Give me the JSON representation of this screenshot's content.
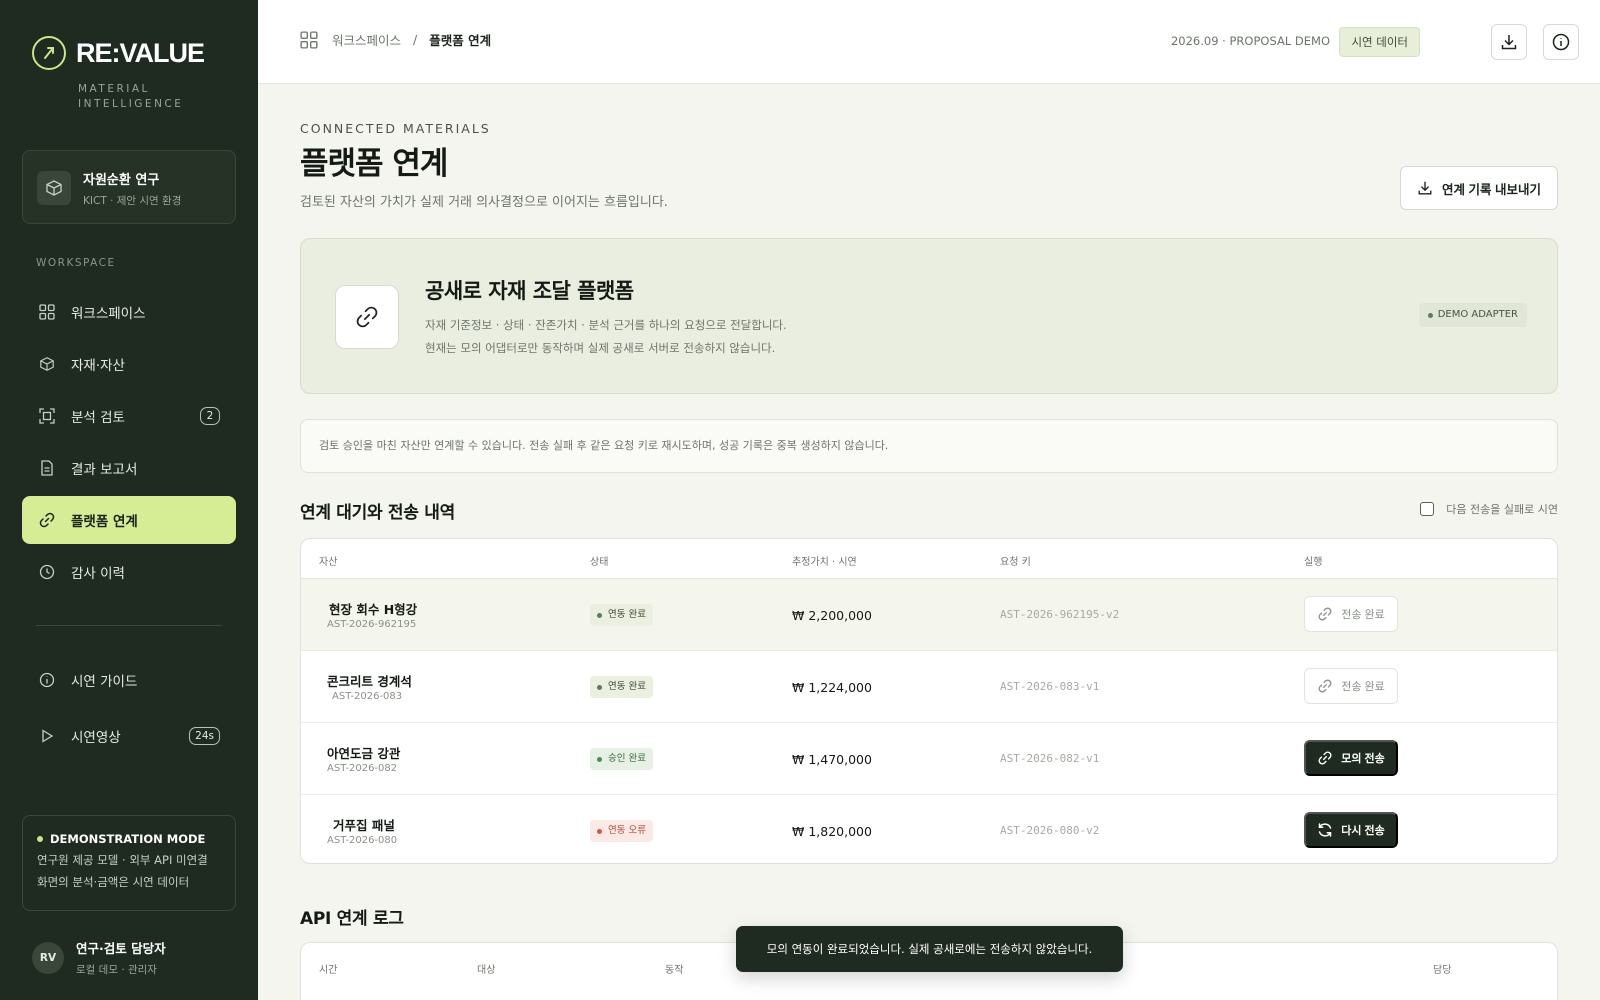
{
  "brand": {
    "name": "RE:VALUE",
    "subtitle": "MATERIAL INTELLIGENCE"
  },
  "org": {
    "title": "자원순환 연구",
    "subtitle": "KICT · 제안 시연 환경"
  },
  "sidebar": {
    "section_label": "WORKSPACE",
    "items": [
      {
        "label": "워크스페이스",
        "icon": "grid-icon"
      },
      {
        "label": "자재·자산",
        "icon": "box-icon"
      },
      {
        "label": "분석 검토",
        "icon": "scan-icon",
        "badge": "2"
      },
      {
        "label": "결과 보고서",
        "icon": "document-icon"
      },
      {
        "label": "플랫폼 연계",
        "icon": "link-icon",
        "active": true
      },
      {
        "label": "감사 이력",
        "icon": "clock-icon"
      }
    ],
    "secondary": [
      {
        "label": "시연 가이드",
        "icon": "info-icon"
      },
      {
        "label": "시연영상",
        "icon": "play-icon",
        "badge": "24s"
      }
    ],
    "demo_mode": {
      "title": "DEMONSTRATION MODE",
      "line1": "연구원 제공 모델 · 외부 API 미연결",
      "line2": "화면의 분석·금액은 시연 데이터"
    },
    "user": {
      "initials": "RV",
      "name": "연구·검토 담당자",
      "role": "로컬 데모 · 관리자"
    }
  },
  "topbar": {
    "breadcrumb": [
      "워크스페이스",
      "플랫폼 연계"
    ],
    "breadcrumb_sep": "/",
    "date": "2026.09 · PROPOSAL DEMO",
    "badge": "시연 데이터"
  },
  "page": {
    "eyebrow": "CONNECTED MATERIALS",
    "title": "플랫폼 연계",
    "description": "검토된 자산의 가치가 실제 거래 의사결정으로 이어지는 흐름입니다.",
    "export_label": "연계 기록 내보내기"
  },
  "platform": {
    "title": "공새로 자재 조달 플랫폼",
    "line1": "자재 기준정보 · 상태 · 잔존가치 · 분석 근거를 하나의 요청으로 전달합니다.",
    "line2": "현재는 모의 어댑터로만 동작하며 실제 공새로 서버로 전송하지 않습니다.",
    "badge": "DEMO ADAPTER"
  },
  "notice": "검토 승인을 마친 자산만 연계할 수 있습니다. 전송 실패 후 같은 요청 키로 재시도하며, 성공 기록은 중복 생성하지 않습니다.",
  "queue": {
    "title": "연계 대기와 전송 내역",
    "checkbox_label": "다음 전송을 실패로 시연",
    "columns": [
      "자산",
      "상태",
      "추정가치 · 시연",
      "요청 키",
      "실행"
    ],
    "rows": [
      {
        "name": "현장 회수 H형강",
        "id": "AST-2026-962195",
        "status": "연동 완료",
        "status_kind": "done",
        "value": "₩ 2,200,000",
        "key": "AST-2026-962195-v2",
        "action": "전송 완료",
        "action_kind": "done"
      },
      {
        "name": "콘크리트 경계석",
        "id": "AST-2026-083",
        "status": "연동 완료",
        "status_kind": "done",
        "value": "₩ 1,224,000",
        "key": "AST-2026-083-v1",
        "action": "전송 완료",
        "action_kind": "done"
      },
      {
        "name": "아연도금 강관",
        "id": "AST-2026-082",
        "status": "승인 완료",
        "status_kind": "approved",
        "value": "₩ 1,470,000",
        "key": "AST-2026-082-v1",
        "action": "모의 전송",
        "action_kind": "send"
      },
      {
        "name": "거푸집 패널",
        "id": "AST-2026-080",
        "status": "연동 오류",
        "status_kind": "error",
        "value": "₩ 1,820,000",
        "key": "AST-2026-080-v2",
        "action": "다시 전송",
        "action_kind": "retry"
      }
    ]
  },
  "log": {
    "title": "API 연계 로그",
    "columns": [
      "시간",
      "대상",
      "동작",
      "담당"
    ]
  },
  "toast": "모의 연동이 완료되었습니다. 실제 공새로에는 전송하지 않았습니다.",
  "colors": {
    "sidebar_bg": "#1f2a20",
    "accent": "#d6ec95",
    "error": "#d0574a"
  }
}
